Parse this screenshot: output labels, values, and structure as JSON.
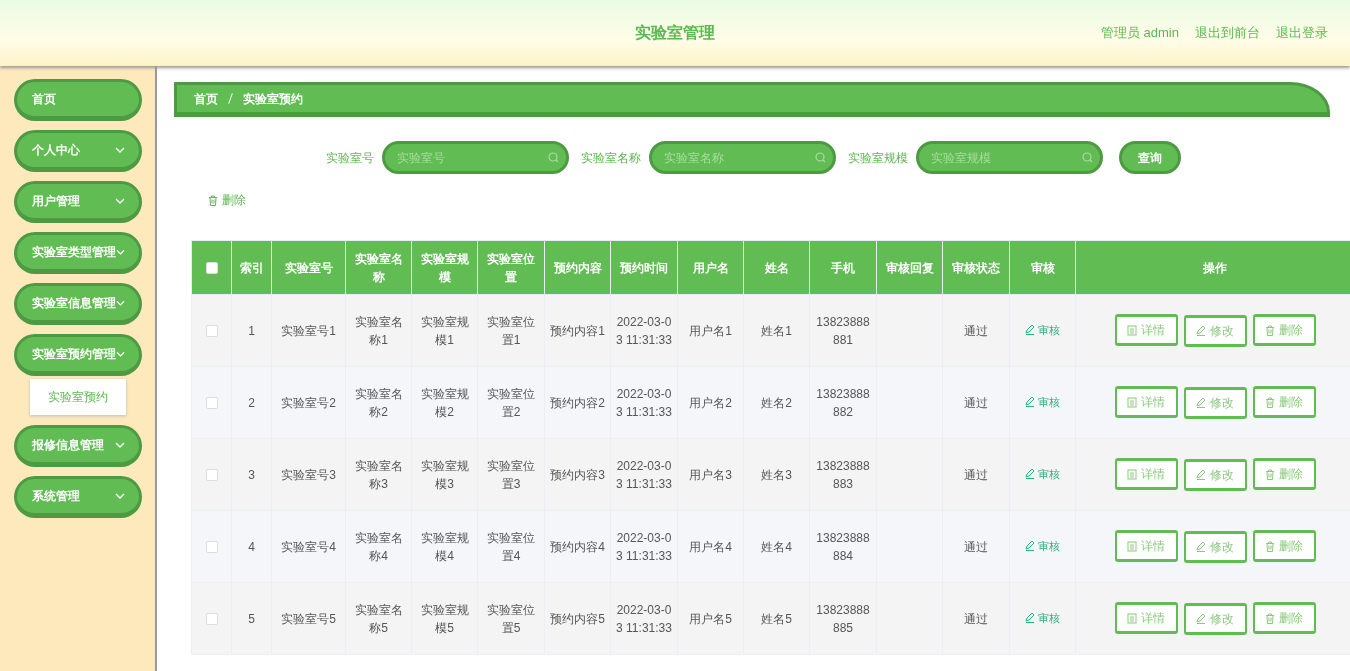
{
  "header": {
    "title": "实验室管理",
    "links": [
      {
        "label": "管理员 admin"
      },
      {
        "label": "退出到前台"
      },
      {
        "label": "退出登录"
      }
    ]
  },
  "sidebar": {
    "items": [
      {
        "label": "首页",
        "kind": "link"
      },
      {
        "label": "个人中心",
        "kind": "menu"
      },
      {
        "label": "用户管理",
        "kind": "menu"
      },
      {
        "label": "实验室类型管理",
        "kind": "menu"
      },
      {
        "label": "实验室信息管理",
        "kind": "menu"
      },
      {
        "label": "实验室预约管理",
        "kind": "menu",
        "children": [
          {
            "label": "实验室预约"
          }
        ]
      },
      {
        "label": "报修信息管理",
        "kind": "menu"
      },
      {
        "label": "系统管理",
        "kind": "menu"
      }
    ]
  },
  "breadcrumb": [
    "首页",
    "实验室预约"
  ],
  "search": {
    "fields": [
      {
        "label": "实验室号",
        "placeholder": "实验室号"
      },
      {
        "label": "实验室名称",
        "placeholder": "实验室名称"
      },
      {
        "label": "实验室规模",
        "placeholder": "实验室规模"
      }
    ],
    "button": "查询"
  },
  "toolbar": {
    "delete": "删除"
  },
  "table": {
    "select_all": {
      "checked": false
    },
    "columns": [
      "索引",
      "实验室号",
      "实验室名称",
      "实验室规模",
      "实验室位置",
      "预约内容",
      "预约时间",
      "用户名",
      "姓名",
      "手机",
      "审核回复",
      "审核状态",
      "审核",
      "操作"
    ],
    "rows": [
      {
        "checked": false,
        "cells": [
          "1",
          "实验室号1",
          "实验室名称1",
          "实验室规模1",
          "实验室位置1",
          "预约内容1",
          "2022-03-03 11:31:33",
          "用户名1",
          "姓名1",
          "13823888881",
          "",
          "通过"
        ],
        "review": "审核",
        "actions": [
          "详情",
          "修改",
          "删除"
        ]
      },
      {
        "checked": false,
        "cells": [
          "2",
          "实验室号2",
          "实验室名称2",
          "实验室规模2",
          "实验室位置2",
          "预约内容2",
          "2022-03-03 11:31:33",
          "用户名2",
          "姓名2",
          "13823888882",
          "",
          "通过"
        ],
        "review": "审核",
        "actions": [
          "详情",
          "修改",
          "删除"
        ]
      },
      {
        "checked": false,
        "cells": [
          "3",
          "实验室号3",
          "实验室名称3",
          "实验室规模3",
          "实验室位置3",
          "预约内容3",
          "2022-03-03 11:31:33",
          "用户名3",
          "姓名3",
          "13823888883",
          "",
          "通过"
        ],
        "review": "审核",
        "actions": [
          "详情",
          "修改",
          "删除"
        ]
      },
      {
        "checked": false,
        "cells": [
          "4",
          "实验室号4",
          "实验室名称4",
          "实验室规模4",
          "实验室位置4",
          "预约内容4",
          "2022-03-03 11:31:33",
          "用户名4",
          "姓名4",
          "13823888884",
          "",
          "通过"
        ],
        "review": "审核",
        "actions": [
          "详情",
          "修改",
          "删除"
        ]
      },
      {
        "checked": false,
        "cells": [
          "5",
          "实验室号5",
          "实验室名称5",
          "实验室规模5",
          "实验室位置5",
          "预约内容5",
          "2022-03-03 11:31:33",
          "用户名5",
          "姓名5",
          "13823888885",
          "",
          "通过"
        ],
        "review": "审核",
        "actions": [
          "详情",
          "修改",
          "删除"
        ]
      }
    ]
  }
}
